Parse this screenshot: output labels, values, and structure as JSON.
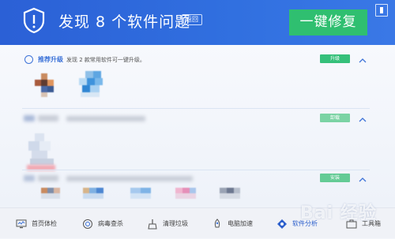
{
  "header": {
    "title": "发现 8 个软件问题",
    "back_label": "返回",
    "fix_label": "一键修复"
  },
  "sections": [
    {
      "label": "推荐升级",
      "description": "发现 2 款常用软件可一键升级。",
      "action": "升级"
    },
    {
      "label": "",
      "description": "",
      "action": "卸载"
    },
    {
      "label": "",
      "description": "",
      "action": "安装"
    }
  ],
  "nav": {
    "items": [
      {
        "label": "首页体检",
        "icon": "monitor-icon"
      },
      {
        "label": "病毒查杀",
        "icon": "virus-scan-icon"
      },
      {
        "label": "清理垃圾",
        "icon": "broom-icon"
      },
      {
        "label": "电脑加速",
        "icon": "rocket-icon"
      },
      {
        "label": "软件分析",
        "icon": "software-analysis-icon"
      },
      {
        "label": "工具箱",
        "icon": "toolbox-icon"
      }
    ]
  },
  "watermark": "Bai 经验",
  "colors": {
    "header": "#2f6bdd",
    "fix_button": "#2fbf70",
    "tag": "#35c07a",
    "accent": "#3d73d8"
  }
}
